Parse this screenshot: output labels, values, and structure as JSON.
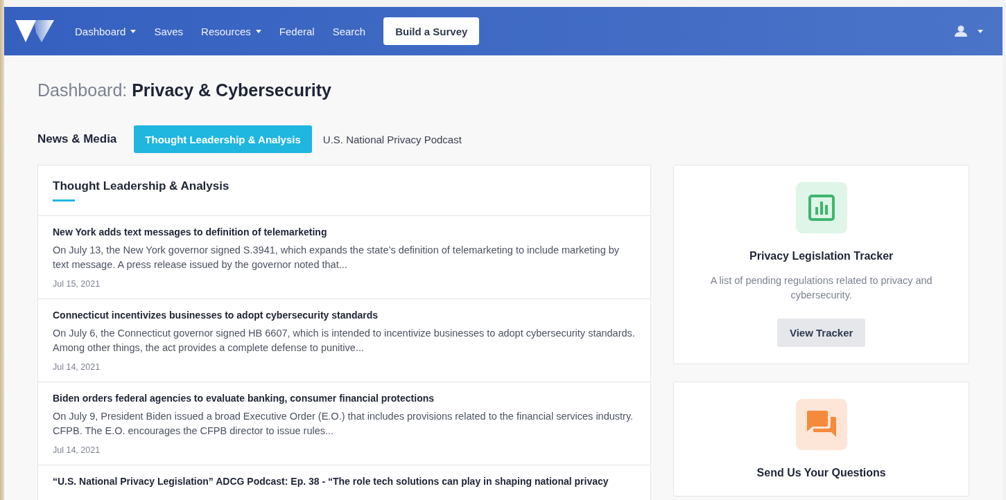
{
  "navbar": {
    "items": [
      {
        "label": "Dashboard",
        "dropdown": true
      },
      {
        "label": "Saves",
        "dropdown": false
      },
      {
        "label": "Resources",
        "dropdown": true
      },
      {
        "label": "Federal",
        "dropdown": false
      },
      {
        "label": "Search",
        "dropdown": false
      }
    ],
    "cta": "Build a Survey"
  },
  "page_title": {
    "prefix": "Dashboard:",
    "name": "Privacy & Cybersecurity"
  },
  "section_label": "News & Media",
  "tabs": [
    {
      "label": "Thought Leadership & Analysis",
      "selected": true
    },
    {
      "label": "U.S. National Privacy Podcast",
      "selected": false
    }
  ],
  "feed": {
    "title": "Thought Leadership & Analysis",
    "articles": [
      {
        "title": "New York adds text messages to definition of telemarketing",
        "summary": "On July 13, the New York governor signed S.3941, which expands the state’s definition of telemarketing to include marketing by text message. A press release issued by the governor noted that...",
        "date": "Jul 15, 2021"
      },
      {
        "title": "Connecticut incentivizes businesses to adopt cybersecurity standards",
        "summary": "On July 6, the Connecticut governor signed HB 6607, which is intended to incentivize businesses to adopt cybersecurity standards. Among other things, the act provides a complete defense to punitive...",
        "date": "Jul 14, 2021"
      },
      {
        "title": "Biden orders federal agencies to evaluate banking, consumer financial protections",
        "summary": "On July 9, President Biden issued a broad Executive Order (E.O.) that includes provisions related to the financial services industry. CFPB. The E.O. encourages the CFPB director to issue rules...",
        "date": "Jul 14, 2021"
      },
      {
        "title": "“U.S. National Privacy Legislation” ADCG Podcast: Ep. 38 - “The role tech solutions can play in shaping national privacy"
      }
    ]
  },
  "side_cards": [
    {
      "kind": "chart",
      "title": "Privacy Legislation Tracker",
      "text": "A list of pending regulations related to privacy and cybersecurity.",
      "button": "View Tracker"
    },
    {
      "kind": "chat",
      "title": "Send Us Your Questions"
    }
  ]
}
